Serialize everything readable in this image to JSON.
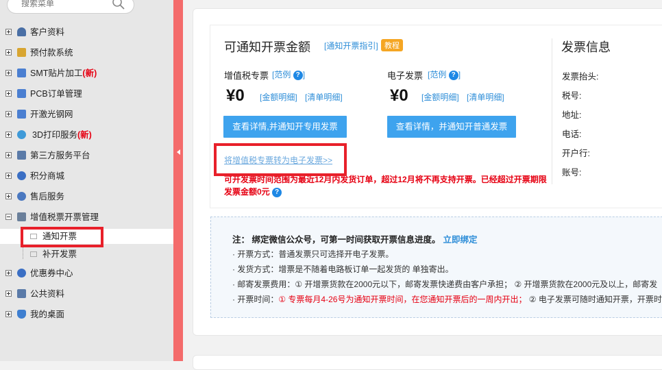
{
  "sidebar": {
    "search_placeholder": "搜索菜单",
    "items": [
      {
        "label": "客户资料",
        "icon": "customer-icon",
        "color": "#4a6fa5"
      },
      {
        "label": "预付款系统",
        "icon": "prepay-icon",
        "color": "#d8a531"
      },
      {
        "label": "SMT贴片加工",
        "new": "新",
        "icon": "smt-icon",
        "color": "#4b7fd1"
      },
      {
        "label": "PCB订单管理",
        "icon": "pcb-icon",
        "color": "#4b7fd1"
      },
      {
        "label": "开激光钢网",
        "icon": "stencil-icon",
        "color": "#4b7fd1"
      },
      {
        "label": "3D打印服务",
        "new": "新",
        "icon": "3d-print-icon",
        "color": "#3f9ad8"
      },
      {
        "label": "第三方服务平台",
        "icon": "third-party-icon",
        "color": "#5a7aa8"
      },
      {
        "label": "积分商城",
        "icon": "points-mall-icon",
        "color": "#3b6fc4"
      },
      {
        "label": "售后服务",
        "icon": "after-sales-icon",
        "color": "#4a78c0"
      },
      {
        "label": "增值税票开票管理",
        "icon": "vat-invoice-icon",
        "color": "#6a7f9a",
        "expanded": true
      },
      {
        "label": "优惠券中心",
        "icon": "coupon-icon",
        "color": "#3b6fc4"
      },
      {
        "label": "公共资料",
        "icon": "public-docs-icon",
        "color": "#5a7aa8"
      },
      {
        "label": "我的桌面",
        "icon": "desktop-icon",
        "color": "#3f7fd0"
      }
    ],
    "subitems": [
      {
        "label": "通知开票"
      },
      {
        "label": "补开发票"
      }
    ]
  },
  "main": {
    "title": "可通知开票金额",
    "guide_link": "[通知开票指引]",
    "tutorial_badge": "教程",
    "vat": {
      "label": "增值税专票",
      "example": "[范例",
      "amount": "¥0",
      "detail1": "[金额明细]",
      "detail2": "[清单明细]",
      "button": "查看详情,并通知开专用发票"
    },
    "einvoice": {
      "label": "电子发票",
      "example": "[范例",
      "amount": "¥0",
      "detail1": "[金额明细]",
      "detail2": "[清单明细]",
      "button": "查看详情，并通知开普通发票"
    },
    "convert_link": "将增值税专票转为电子发票>>",
    "warning_line1": "可开发票时间范围为最近12月内发货订单，超过12月将不再支持开票。已经超过开票期限",
    "warning_line2": "发票金额0元",
    "invoice_info": {
      "title": "发票信息",
      "fields": [
        "发票抬头:",
        "税号:",
        "地址:",
        "电话:",
        "开户行:",
        "账号:"
      ]
    }
  },
  "notice": {
    "heading": "注：  绑定微信公众号，可第一时间获取开票信息进度。",
    "bind_link": "立即绑定",
    "lines": [
      {
        "label": "· 开票方式：",
        "text": "普通发票只可选择开电子发票。"
      },
      {
        "label": "· 发货方式：",
        "text": "增票是不随着电路板订单一起发货的 单独寄出。"
      },
      {
        "label": "· 邮寄发票费用：",
        "text": "① 开增票货款在2000元以下，邮寄发票快递费由客户承担； ② 开增票货款在2000元及以上，邮寄发"
      },
      {
        "label": "· 开票时间：",
        "red": "① 专票每月4-26号为通知开票时间，在您通知开票后的一周内开出；",
        "text": " ② 电子发票可随时通知开票，开票时"
      }
    ]
  },
  "colors": {
    "accent": "#3ea3ee",
    "highlight": "#e8202a",
    "collapse_bar": "#f46b6b",
    "badge": "#f5a623"
  }
}
